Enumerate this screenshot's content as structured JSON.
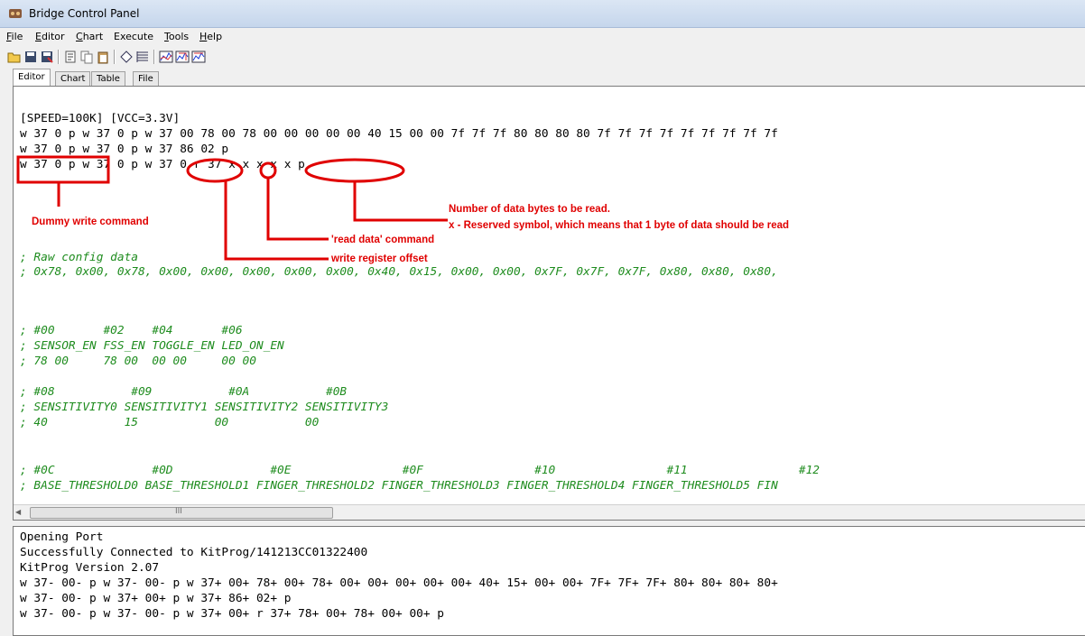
{
  "window": {
    "title": "Bridge Control Panel"
  },
  "menu": [
    {
      "label": "File",
      "u": "F",
      "rest": "ile"
    },
    {
      "label": "Editor",
      "u": "E",
      "rest": "ditor"
    },
    {
      "label": "Chart",
      "u": "C",
      "rest": "hart"
    },
    {
      "label": "Execute",
      "u": "",
      "rest": "Execute"
    },
    {
      "label": "Tools",
      "u": "T",
      "rest": "ools"
    },
    {
      "label": "Help",
      "u": "H",
      "rest": "elp"
    }
  ],
  "toolbar_icons": [
    "open-icon",
    "save-icon",
    "save-as-icon",
    "cut-icon",
    "copy-icon",
    "paste-icon",
    "clear-icon",
    "list-icon",
    "chart-icon",
    "chart-zoom-icon",
    "chart-export-icon"
  ],
  "tabs": [
    "Editor",
    "Chart",
    "Table",
    "File"
  ],
  "editor": {
    "lines": [
      "[SPEED=100K] [VCC=3.3V]",
      "w 37 0 p w 37 0 p w 37 00 78 00 78 00 00 00 00 00 40 15 00 00 7f 7f 7f 80 80 80 80 7f 7f 7f 7f 7f 7f 7f 7f 7f",
      "w 37 0 p w 37 0 p w 37 86 02 p",
      "w 37 0 p w 37 0 p w 37 0 r 37 x x x x x p"
    ],
    "comments": [
      "; Raw config data",
      "; 0x78, 0x00, 0x78, 0x00, 0x00, 0x00, 0x00, 0x00, 0x40, 0x15, 0x00, 0x00, 0x7F, 0x7F, 0x7F, 0x80, 0x80, 0x80,",
      "",
      "",
      "; #00       #02    #04       #06",
      "; SENSOR_EN FSS_EN TOGGLE_EN LED_ON_EN",
      "; 78 00     78 00  00 00     00 00",
      "",
      "; #08           #09           #0A           #0B",
      "; SENSITIVITY0 SENSITIVITY1 SENSITIVITY2 SENSITIVITY3",
      "; 40           15           00           00",
      "",
      "; #0C              #0D              #0E                #0F                #10                #11                #12",
      "; BASE_THRESHOLD0 BASE_THRESHOLD1 FINGER_THRESHOLD2 FINGER_THRESHOLD3 FINGER_THRESHOLD4 FINGER_THRESHOLD5 FIN"
    ]
  },
  "annotations": {
    "dummy_write": "Dummy write command",
    "num_bytes": "Number of data bytes to be read.",
    "reserved": "x - Reserved symbol, which means that 1 byte of data should be read",
    "read_data": "'read data' command",
    "write_offset": "write register offset",
    "color": "#e00000"
  },
  "console": {
    "lines": [
      "Opening Port",
      "Successfully Connected to KitProg/141213CC01322400",
      "KitProg Version 2.07",
      "w 37- 00- p w 37- 00- p w 37+ 00+ 78+ 00+ 78+ 00+ 00+ 00+ 00+ 00+ 40+ 15+ 00+ 00+ 7F+ 7F+ 7F+ 80+ 80+ 80+ 80+",
      "w 37- 00- p w 37+ 00+ p w 37+ 86+ 02+ p",
      "w 37- 00- p w 37- 00- p w 37+ 00+ r 37+ 78+ 00+ 78+ 00+ 00+ p"
    ]
  },
  "scrollbar": {
    "grip": "III"
  }
}
